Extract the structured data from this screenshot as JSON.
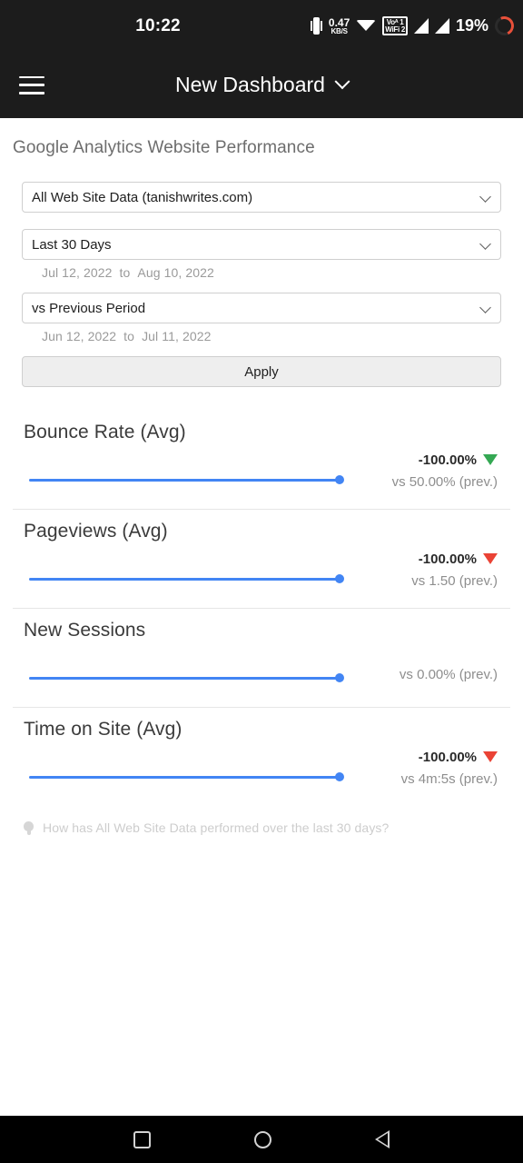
{
  "status_bar": {
    "clock": "10:22",
    "network_rate": "0.47",
    "network_unit": "KB/S",
    "volte_line1": "Voᴬ 1",
    "volte_line2": "WiFi 2",
    "battery_percent": "19%",
    "icons": [
      "vibrate-icon",
      "network-speed-icon",
      "wifi-icon",
      "volte-wifi-icon",
      "signal-bars-icon-1",
      "signal-bars-icon-2",
      "battery-ring-icon"
    ]
  },
  "app_bar": {
    "menu_icon": "hamburger-menu-icon",
    "title": "New Dashboard",
    "dropdown_icon": "chevron-down-icon"
  },
  "page": {
    "title": "Google Analytics Website Performance"
  },
  "form": {
    "property_select": {
      "value": "All Web Site Data (tanishwrites.com)",
      "icon": "chevron-down-icon"
    },
    "period_select": {
      "value": "Last 30 Days",
      "icon": "chevron-down-icon"
    },
    "period_range": {
      "start": "Jul 12, 2022",
      "separator": "to",
      "end": "Aug 10, 2022"
    },
    "compare_select": {
      "value": "vs Previous Period",
      "icon": "chevron-down-icon"
    },
    "compare_range": {
      "start": "Jun 12, 2022",
      "separator": "to",
      "end": "Jul 11, 2022"
    },
    "apply_label": "Apply"
  },
  "metrics": [
    {
      "title": "Bounce Rate (Avg)",
      "delta": "-100.00%",
      "trend": "down",
      "trend_color": "#34a853",
      "previous": "vs 50.00% (prev.)",
      "slider_percent": 100
    },
    {
      "title": "Pageviews (Avg)",
      "delta": "-100.00%",
      "trend": "down",
      "trend_color": "#ea4335",
      "previous": "vs 1.50 (prev.)",
      "slider_percent": 100
    },
    {
      "title": "New Sessions",
      "delta": "",
      "trend": "none",
      "trend_color": "",
      "previous": "vs 0.00% (prev.)",
      "slider_percent": 100
    },
    {
      "title": "Time on Site (Avg)",
      "delta": "-100.00%",
      "trend": "down",
      "trend_color": "#ea4335",
      "previous": "vs 4m:5s (prev.)",
      "slider_percent": 100
    }
  ],
  "hint": {
    "icon": "lightbulb-icon",
    "text": "How has All Web Site Data performed over the last 30 days?"
  },
  "nav_bar": {
    "recents": "recents-square-icon",
    "home": "home-circle-icon",
    "back": "back-triangle-icon"
  },
  "colors": {
    "accent_blue": "#4285F4",
    "positive_green": "#34a853",
    "negative_red": "#ea4335",
    "chrome_dark": "#1c1c1c"
  }
}
